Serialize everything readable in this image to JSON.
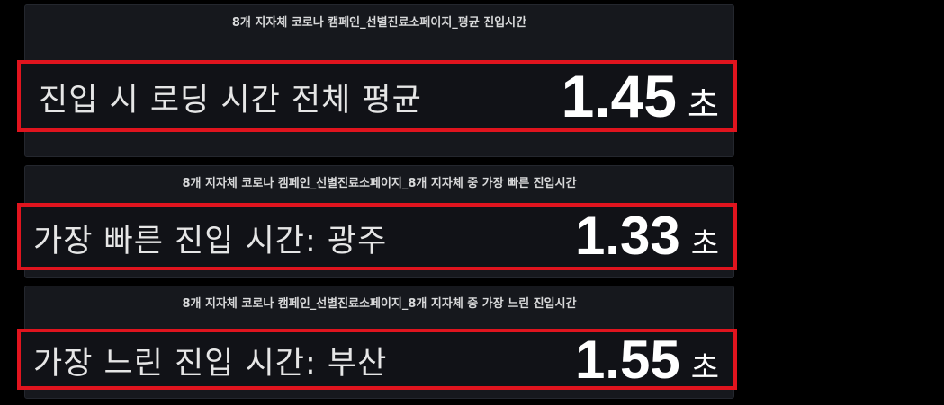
{
  "panels": [
    {
      "title": "8개 지자체 코로나 캠페인_선별진료소페이지_평균 진입시간",
      "label": "진입 시 로딩 시간 전체 평균",
      "value": "1.45",
      "unit": "초"
    },
    {
      "title": "8개 지자체 코로나 캠페인_선별진료소페이지_8개 지자체 중 가장 빠른 진입시간",
      "label": "가장 빠른 진입 시간: 광주",
      "value": "1.33",
      "unit": "초"
    },
    {
      "title": "8개 지자체 코로나 캠페인_선별진료소페이지_8개 지자체 중 가장 느린 진입시간",
      "label": "가장 느린 진입 시간: 부산",
      "value": "1.55",
      "unit": "초"
    }
  ],
  "colors": {
    "background": "#000000",
    "panel_bg": "#16181d",
    "highlight_border": "#e0141e",
    "text": "#ffffff"
  }
}
